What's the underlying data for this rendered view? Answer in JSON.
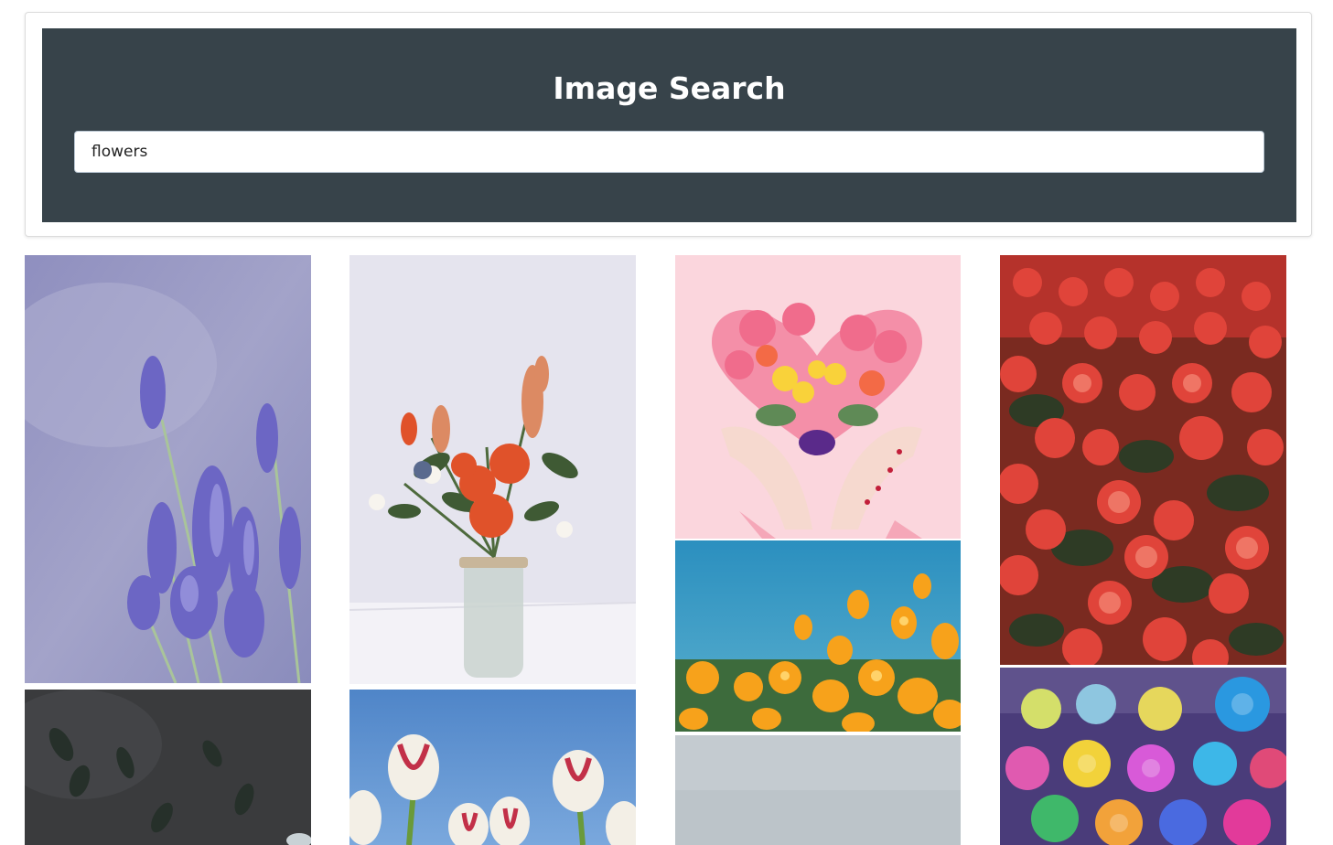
{
  "header": {
    "title": "Image Search"
  },
  "search": {
    "value": "flowers",
    "placeholder": ""
  },
  "colors": {
    "banner": "#37434a",
    "card_border": "#dcdcdc"
  },
  "results": [
    {
      "name": "lavender-photo"
    },
    {
      "name": "dark-eucalyptus-photo"
    },
    {
      "name": "bouquet-in-jar-photo"
    },
    {
      "name": "tulips-sky-photo"
    },
    {
      "name": "heart-flowers-hands-photo"
    },
    {
      "name": "yellow-poppies-photo"
    },
    {
      "name": "grey-sky-photo"
    },
    {
      "name": "red-begonias-photo"
    },
    {
      "name": "rainbow-roses-photo"
    }
  ]
}
